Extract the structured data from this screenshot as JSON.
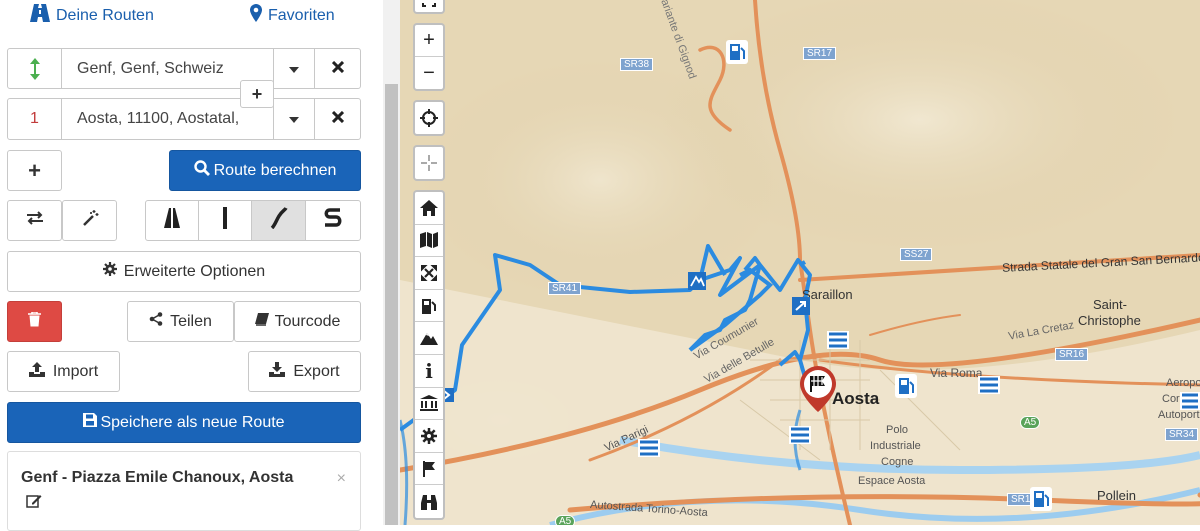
{
  "header": {
    "routes_label": "Deine Routen",
    "favorites_label": "Favoriten"
  },
  "stops": [
    {
      "marker": "↕",
      "value": "Genf, Genf, Schweiz"
    },
    {
      "marker": "1",
      "value": "Aosta, 11100, Aostatal,"
    }
  ],
  "actions": {
    "insert_stop": "+",
    "add_stop": "+",
    "calculate": "Route berechnen",
    "advanced": "Erweiterte Optionen",
    "share": "Teilen",
    "tourcode": "Tourcode",
    "import": "Import",
    "export": "Export",
    "save_new": "Speichere als neue Route"
  },
  "saved_route": {
    "title": "Genf - Piazza Emile Chanoux, Aosta",
    "close": "×"
  },
  "map": {
    "zoom_in": "+",
    "zoom_out": "−",
    "info_label": "i",
    "places": {
      "aosta": "Aosta",
      "saraillon": "Saraillon",
      "saint_christophe_1": "Saint-",
      "saint_christophe_2": "Christophe",
      "pollein": "Pollein",
      "polo_1": "Polo",
      "polo_2": "Industriale",
      "polo_3": "Cogne",
      "espace": "Espace Aosta",
      "aeroporto_1": "Aeropor",
      "aeroporto_2": "Corrado",
      "aeroporto_3": "Autoporto"
    },
    "streets": {
      "ss27": "Strada Statale del Gran San Bernardo Gal",
      "via_roma": "Via Roma",
      "via_cretaz": "Via La Cretaz",
      "via_parigi": "Via Parigi",
      "autostrada": "Autostrada Torino-Aosta",
      "via_betulle": "Via delle Betulle",
      "via_coumunier": "Via Coumunier",
      "variante": "Variante di Gignod"
    },
    "road_badges": {
      "sr38": "SR38",
      "sr17": "SR17",
      "sr41": "SR41",
      "ss27": "SS27",
      "sr16": "SR16",
      "a5": "A5",
      "sr34": "SR34",
      "sr1": "SR1",
      "a5b": "A5"
    }
  },
  "colors": {
    "primary": "#1a64b8",
    "danger": "#de4a44",
    "route": "#2b8be0",
    "road": "#e3915a"
  }
}
